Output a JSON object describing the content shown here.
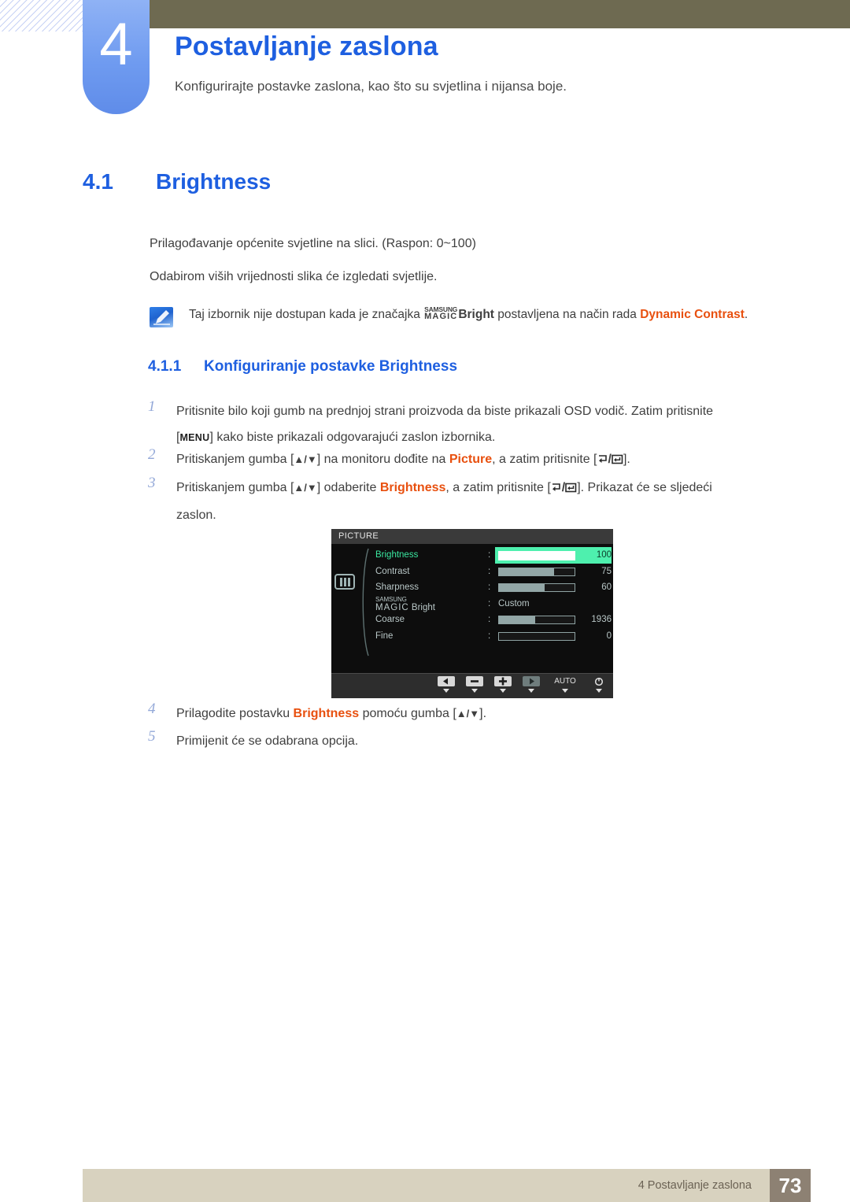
{
  "header": {
    "chapter_number": "4",
    "chapter_title": "Postavljanje zaslona",
    "chapter_subtitle": "Konfigurirajte postavke zaslona, kao što su svjetlina i nijansa boje.",
    "accent_color": "#1e5fe0",
    "badge_color": "#6f9bf0",
    "bar_color": "#6e6a51"
  },
  "section": {
    "index": "4.1",
    "title": "Brightness",
    "paragraph_1": "Prilagođavanje općenite svjetline na slici. (Raspon: 0~100)",
    "paragraph_2": "Odabirom viših vrijednosti slika će izgledati svjetlije."
  },
  "note": {
    "icon": "note-pen-icon",
    "text_before": "Taj izbornik nije dostupan kada je značajka",
    "magic_samsung": "SAMSUNG",
    "magic_magic": "MAGIC",
    "magic_bright": "Bright",
    "text_middle": "postavljena na način rada",
    "highlight": "Dynamic Contrast",
    "text_after": ".",
    "highlight_color": "#e8500f"
  },
  "subsection": {
    "index": "4.1.1",
    "title": "Konfiguriranje postavke Brightness"
  },
  "steps": [
    {
      "number": "1",
      "line1": "Pritisnite bilo koji gumb na prednjoj strani proizvoda da biste prikazali OSD vodič. Zatim pritisnite",
      "key": "MENU",
      "line2": "kako biste prikazali odgovarajući zaslon izbornika."
    },
    {
      "number": "2",
      "part1": "Pritiskanjem gumba [",
      "arrows": "▲/▼",
      "part2": "] na monitoru dođite na",
      "highlight": "Picture",
      "part3": ", a zatim pritisnite [",
      "part4": "]."
    },
    {
      "number": "3",
      "part1": "Pritiskanjem gumba [",
      "arrows": "▲/▼",
      "part2": "] odaberite",
      "highlight": "Brightness",
      "part3": ", a zatim pritisnite [",
      "part4": "]. Prikazat će se sljedeći",
      "line2": "zaslon."
    },
    {
      "number": "4",
      "part1": "Prilagodite postavku",
      "highlight": "Brightness",
      "part2": "pomoću gumba [",
      "arrows": "▲/▼",
      "part3": "]."
    },
    {
      "number": "5",
      "part1": "Primijenit će se odabrana opcija."
    }
  ],
  "osd": {
    "title": "PICTURE",
    "category_icon": "picture-bars-icon",
    "selected_row": "Brightness",
    "selected_fill_color": "#4ef0ae",
    "rows": [
      {
        "label": "Brightness",
        "value": "100",
        "type": "slider",
        "percent": 100,
        "selected": true
      },
      {
        "label": "Contrast",
        "value": "75",
        "type": "slider",
        "percent": 73,
        "selected": false
      },
      {
        "label": "Sharpness",
        "value": "60",
        "type": "slider",
        "percent": 60,
        "selected": false
      },
      {
        "label": "MAGIC Bright",
        "label_top": "SAMSUNG",
        "label_main": "MAGIC",
        "label_suffix": "Bright",
        "value": "Custom",
        "type": "text",
        "selected": false
      },
      {
        "label": "Coarse",
        "value": "1936",
        "type": "slider",
        "percent": 48,
        "selected": false
      },
      {
        "label": "Fine",
        "value": "0",
        "type": "slider",
        "percent": 0,
        "selected": false
      }
    ],
    "buttons": [
      {
        "name": "left-arrow-button",
        "icon": "arrow-left-icon",
        "label": ""
      },
      {
        "name": "minus-button",
        "icon": "minus-icon",
        "label": ""
      },
      {
        "name": "plus-button",
        "icon": "plus-icon",
        "label": ""
      },
      {
        "name": "right-arrow-button",
        "icon": "arrow-right-icon",
        "label": "",
        "dim": true
      },
      {
        "name": "auto-button",
        "icon": "",
        "label": "AUTO"
      },
      {
        "name": "power-button",
        "icon": "power-icon",
        "label": ""
      }
    ]
  },
  "footer": {
    "text": "4 Postavljanje zaslona",
    "page_number": "73",
    "bar_color": "#d8d2bf",
    "page_box_color": "#8d8173"
  }
}
